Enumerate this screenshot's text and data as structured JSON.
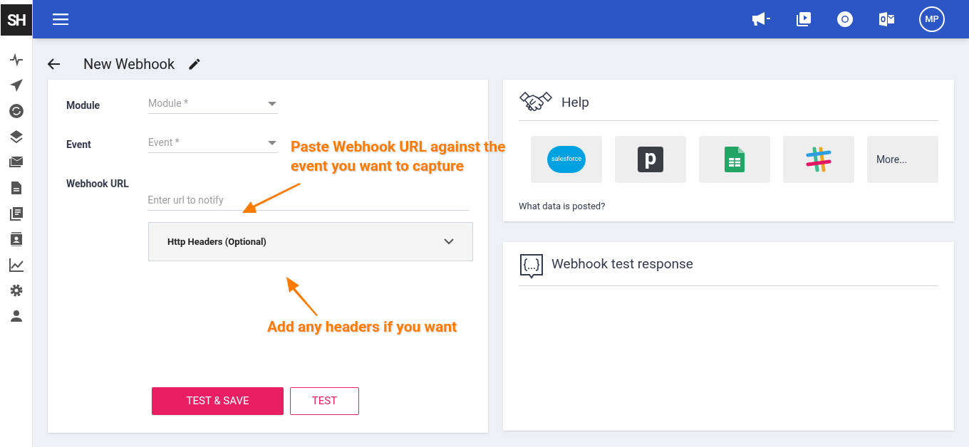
{
  "logo": "SH",
  "user": {
    "initials": "MP"
  },
  "page": {
    "title": "New Webhook"
  },
  "form": {
    "fields": [
      {
        "label": "Module",
        "kind": "select",
        "placeholder": "Module *"
      },
      {
        "label": "Event",
        "kind": "select",
        "placeholder": "Event *"
      },
      {
        "label": "Webhook URL",
        "kind": "text",
        "placeholder": "Enter url to notify"
      }
    ],
    "headers_panel": {
      "title": "Http Headers (Optional)",
      "expanded": false
    },
    "buttons": [
      {
        "label": "TEST & SAVE",
        "kind": "primary"
      },
      {
        "label": "TEST",
        "kind": "outline"
      }
    ]
  },
  "help": {
    "title": "Help",
    "integrations": [
      {
        "kind": "salesforce",
        "label": "salesforce"
      },
      {
        "kind": "pipedrive",
        "label": "p"
      },
      {
        "kind": "sheets"
      },
      {
        "kind": "slack"
      },
      {
        "kind": "more",
        "label": "More..."
      }
    ],
    "link": "What data is posted?"
  },
  "test_response": {
    "title": "Webhook test response"
  },
  "annotations": [
    {
      "text": "Paste Webhook URL against the event you want to capture"
    },
    {
      "text": "Add any headers if you want"
    }
  ]
}
